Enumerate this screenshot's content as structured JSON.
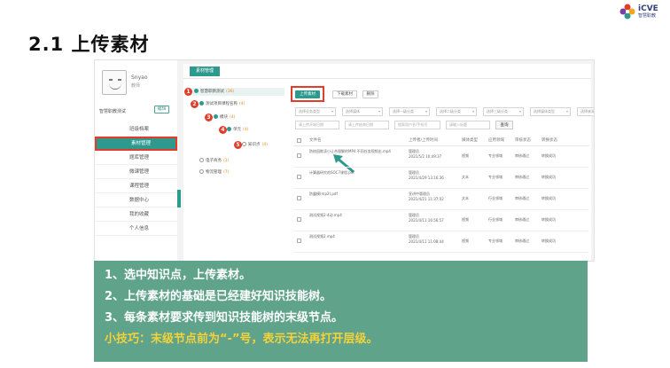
{
  "slide": {
    "title": "2.1 上传素材"
  },
  "logo": {
    "text": "iCVE",
    "sub": "智慧职教"
  },
  "profile": {
    "name": "Snyao",
    "role": "教师",
    "org": "智慧职教测试",
    "edit_label": "编辑"
  },
  "menu": {
    "items": [
      {
        "label": "班级档案",
        "active": false
      },
      {
        "label": "素材管理",
        "active": true
      },
      {
        "label": "题库管理",
        "active": false
      },
      {
        "label": "微课管理",
        "active": false
      },
      {
        "label": "课程管理",
        "active": false
      },
      {
        "label": "数据中心",
        "active": false
      },
      {
        "label": "我的收藏",
        "active": false
      },
      {
        "label": "个人信息",
        "active": false
      }
    ]
  },
  "main": {
    "tab_label": "素材管理"
  },
  "tree": {
    "nodes": [
      {
        "badge": "1",
        "label": "智慧职教测试",
        "count": "(36)"
      },
      {
        "badge": "2",
        "label": "测试项目课程名称",
        "count": "(4)"
      },
      {
        "badge": "3",
        "label": "模块",
        "count": "(4)"
      },
      {
        "badge": "4",
        "label": "单元",
        "count": "(4)"
      },
      {
        "badge": "5",
        "label": "知识点",
        "count": "(4)"
      },
      {
        "badge": "",
        "label": "电子商务",
        "count": "(1)"
      },
      {
        "badge": "",
        "label": "物流管理",
        "count": "(7)"
      }
    ]
  },
  "toolbar": {
    "upload_label": "上传素材",
    "download_label": "下载素材",
    "delete_label": "删除"
  },
  "filters": {
    "selects": [
      "选择业务类型",
      "选择媒体",
      "选择一级分类",
      "选择二级分类",
      "选择三级分类",
      "选择媒体类型",
      "选择来源"
    ],
    "inputs": [
      "请上传开始日期",
      "请上传结束日期",
      "搜索用户名/手机号",
      "请输入标题"
    ],
    "search_label": "查询"
  },
  "grid": {
    "headers": [
      "文件名",
      "上传者/上传时间",
      "媒体类型",
      "应用领域",
      "审核状态",
      "转换状态"
    ],
    "rows": [
      {
        "name": "防校园欺凌小让合理解的MP4 不同任务视频出.mp4",
        "uploader": "管理员",
        "time": "2021/5/2 10:49:37",
        "type": "视频",
        "field": "专业领域",
        "audit": "审核通过",
        "convert": "转换成功"
      },
      {
        "name": "计算器研究的SOC7课程.pdf",
        "uploader": "管理员",
        "time": "2021/4/29 13:16:36",
        "type": "文本",
        "field": "专业领域",
        "audit": "审核通过",
        "convert": "转换成功"
      },
      {
        "name": "防震模(mp2).pdf",
        "uploader": "宣讲中管理员",
        "time": "2021/4/21 11:37:02",
        "type": "文本",
        "field": "行业领域",
        "audit": "审核通过",
        "convert": "转换成功"
      },
      {
        "name": "测试视频2-4动.mp4",
        "uploader": "管理员",
        "time": "2021/4/11 16:56:57",
        "type": "视频",
        "field": "行业领域",
        "audit": "审核通过",
        "convert": "转换成功"
      },
      {
        "name": "测试视频2.mp4",
        "uploader": "管理员",
        "time": "2021/4/11 11:08:44",
        "type": "视频",
        "field": "专业领域",
        "audit": "审核通过",
        "convert": "转换成功"
      }
    ]
  },
  "banner": {
    "lines": [
      "1、选中知识点，上传素材。",
      "2、上传素材的基础是已经建好知识技能树。",
      "3、每条素材要求传到知识技能树的末级节点。"
    ],
    "tip": "小技巧：末级节点前为“-”号，表示无法再打开层级。"
  },
  "colors": {
    "accent": "#2d9a8d",
    "highlight": "#e23c2b",
    "banner": "#5fa38b",
    "tip": "#f4d23a"
  }
}
